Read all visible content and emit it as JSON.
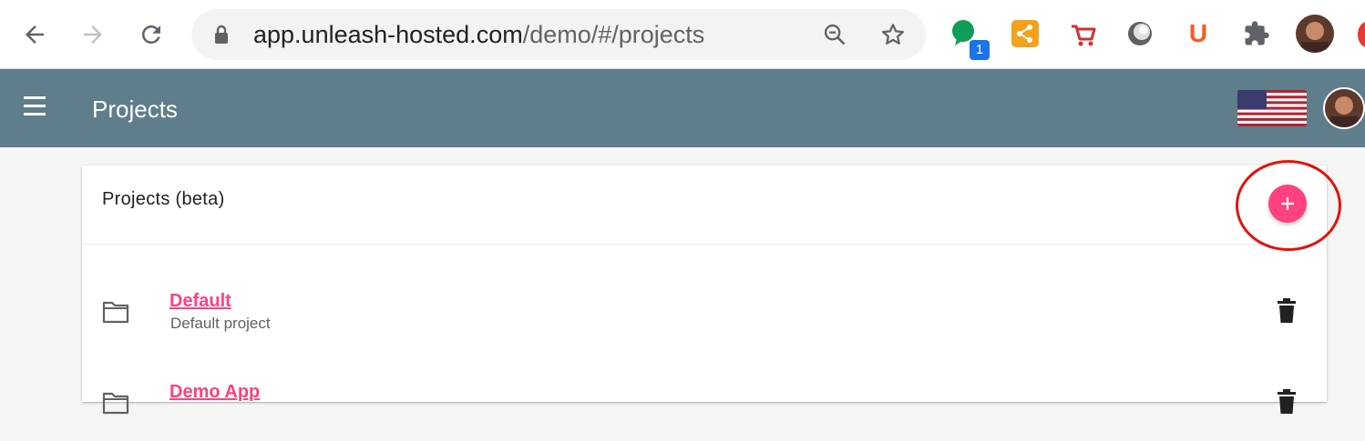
{
  "browser": {
    "url_host": "app.unleash-hosted.com",
    "url_path": "/demo/#/projects",
    "extension_badge": "1",
    "extension_u_label": "U"
  },
  "appbar": {
    "title": "Projects"
  },
  "card": {
    "title": "Projects (beta)",
    "projects": [
      {
        "name": "Default",
        "description": "Default project"
      },
      {
        "name": "Demo App",
        "description": ""
      }
    ]
  },
  "colors": {
    "appbar": "#607d8b",
    "accent": "#ff4081",
    "annotation": "#e3120b"
  }
}
